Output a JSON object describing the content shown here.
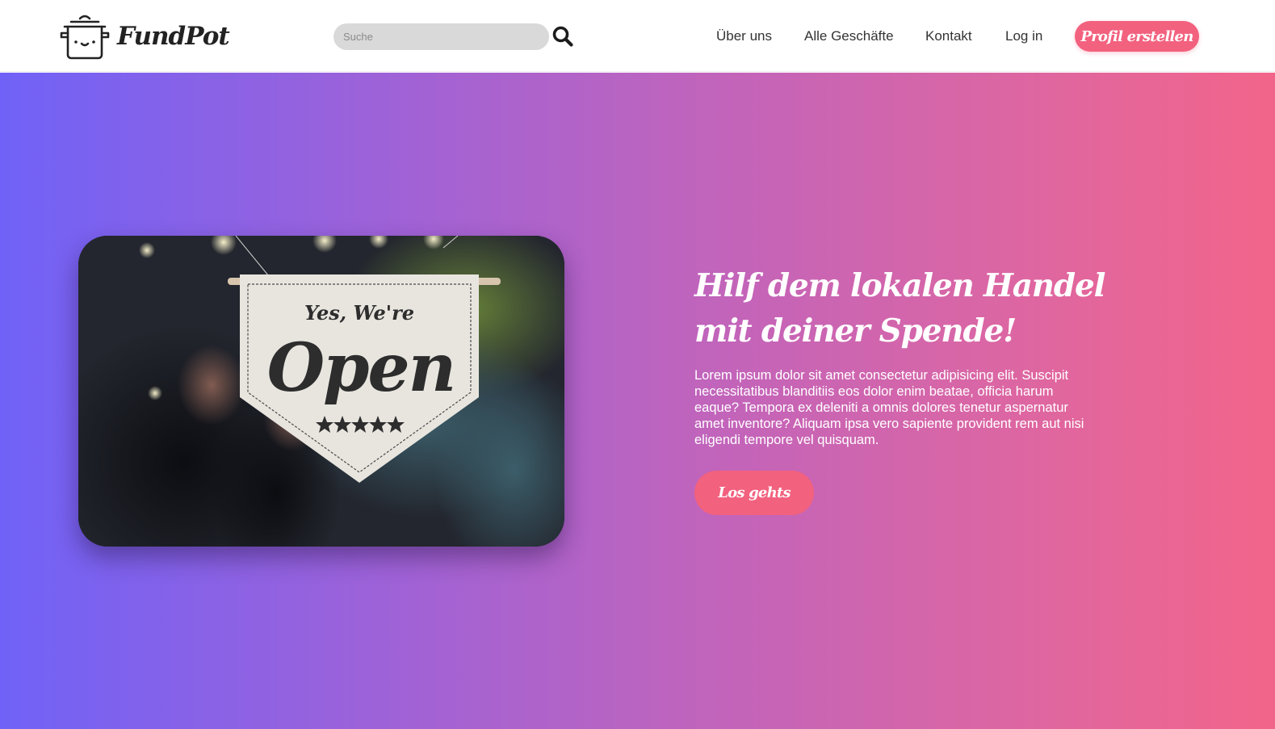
{
  "brand": {
    "name": "FundPot",
    "logo_icon": "cooking-pot-icon"
  },
  "search": {
    "placeholder": "Suche",
    "value": "",
    "icon": "search-icon"
  },
  "nav": {
    "items": [
      {
        "label": "Über uns"
      },
      {
        "label": "Alle Geschäfte"
      },
      {
        "label": "Kontakt"
      },
      {
        "label": "Log in"
      }
    ],
    "cta_label": "Profil erstellen"
  },
  "hero": {
    "headline": "Hilf dem lokalen Handel mit deiner Spende!",
    "body": "Lorem ipsum dolor sit amet consectetur adipisicing elit. Suscipit necessitatibus blanditiis eos dolor enim beatae, officia harum eaque? Tempora ex deleniti a omnis dolores tenetur aspernatur amet inventore? Aliquam ipsa vero sapiente provident rem aut nisi eligendi tempore vel quisquam.",
    "cta_label": "Los gehts",
    "photo": {
      "banner_line1": "Yes, We're",
      "banner_line2": "Open",
      "rating_stars": 5
    }
  },
  "colors": {
    "accent": "#f2617e",
    "gradient_start": "#7062f7",
    "gradient_end": "#f2658a"
  }
}
